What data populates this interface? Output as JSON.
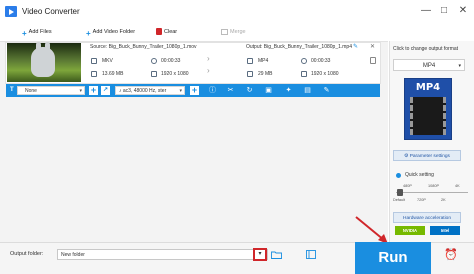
{
  "window": {
    "title": "Video Converter",
    "controls": [
      "minimize-icon",
      "maximize-icon",
      "close-icon"
    ]
  },
  "toolbar": {
    "add_files": "Add Files",
    "add_video_folder": "Add Video Folder",
    "clear": "Clear",
    "merge": "Merge"
  },
  "task": {
    "source_label": "Source: Big_Buck_Bunny_Trailer_1080p_1.mov",
    "output_label": "Output: Big_Buck_Bunny_Trailer_1080p_1.mp4",
    "source": {
      "format": "MKV",
      "duration": "00:00:33",
      "size": "13.69 MB",
      "resolution": "1920 x 1080"
    },
    "output": {
      "format": "MP4",
      "duration": "00:00:33",
      "size": "29 MB",
      "resolution": "1920 x 1080"
    }
  },
  "edit_bar": {
    "subtitle_value": "None",
    "audio_value": "ac3, 48000 Hz, ster",
    "tools": [
      "info-icon",
      "crop-icon",
      "rotate-icon",
      "trim-icon",
      "effects-icon",
      "watermark-icon",
      "edit-icon"
    ]
  },
  "right_panel": {
    "format_hint": "Click to change output format",
    "format_value": "MP4",
    "format_icon_text": "MP4",
    "parameter_settings": "Parameter settings",
    "quick_setting": "Quick setting",
    "ticks_top": [
      "480P",
      "1080P",
      "4K"
    ],
    "ticks_bottom": [
      "Default",
      "720P",
      "2K"
    ],
    "hw_accel": "Hardware acceleration",
    "gpu": [
      "NVIDIA",
      "Intel"
    ]
  },
  "bottom": {
    "output_folder_label": "Output folder:",
    "output_folder_value": "New folder",
    "run": "Run"
  }
}
